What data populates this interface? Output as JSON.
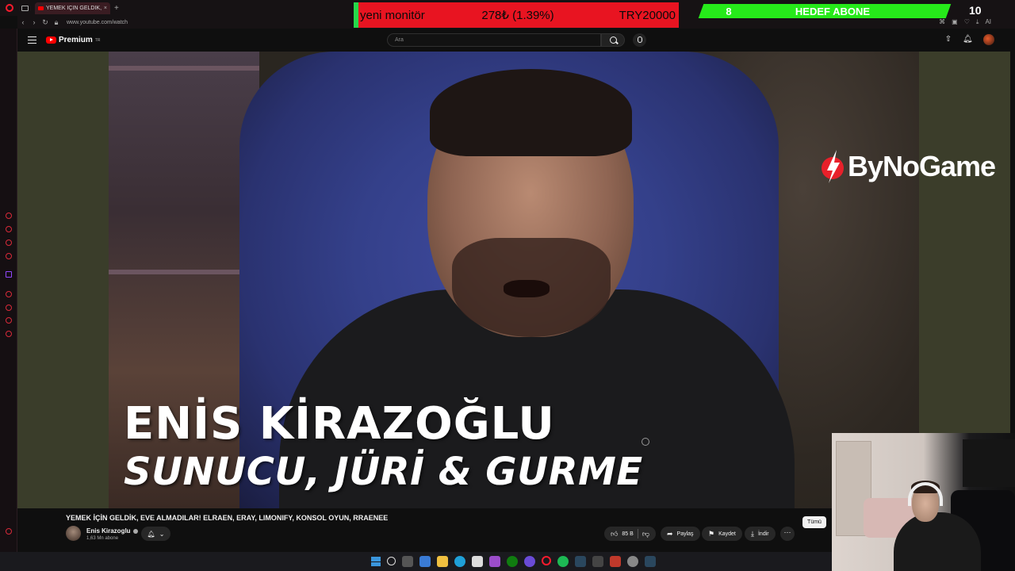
{
  "browser": {
    "tab_title": "YEMEK İÇİN GELDİK, E",
    "url": "www.youtube.com/watch",
    "ext_label": "AI"
  },
  "overlay": {
    "donation": {
      "label": "yeni monitör",
      "amount": "278₺ (1.39%)",
      "target": "TRY20000",
      "progress_percent": 1.39,
      "fill_color": "#26d84a",
      "bar_color": "#e81421"
    },
    "sub_goal": {
      "current": "8",
      "title": "HEDEF ABONE",
      "target": "10",
      "color": "#26ea1a"
    }
  },
  "youtube": {
    "logo_text": "Premium",
    "logo_sup": "TR",
    "search_placeholder": "Ara",
    "accent": "#ff0000"
  },
  "video": {
    "brand": "ByNoGame",
    "lower_third_name": "ENİS KİRAZOĞLU",
    "lower_third_role": "SUNUCU, JÜRİ & GURME"
  },
  "details": {
    "title": "YEMEK İÇİN GELDİK, EVE ALMADILAR! ELRAEN, ERAY, LIMONIFY, KONSOL OYUN, RRAENEE",
    "channel_name": "Enis Kirazoglu",
    "channel_subs": "1,63 Mn abone",
    "likes": "85 B",
    "share_label": "Paylaş",
    "save_label": "Kaydet",
    "download_label": "İndir",
    "more_label": "⋯",
    "chip_all": "Tümü"
  },
  "icons": {
    "upload": "upload-icon",
    "notifications": "bell-icon",
    "search": "search-icon",
    "mic": "mic-icon"
  }
}
